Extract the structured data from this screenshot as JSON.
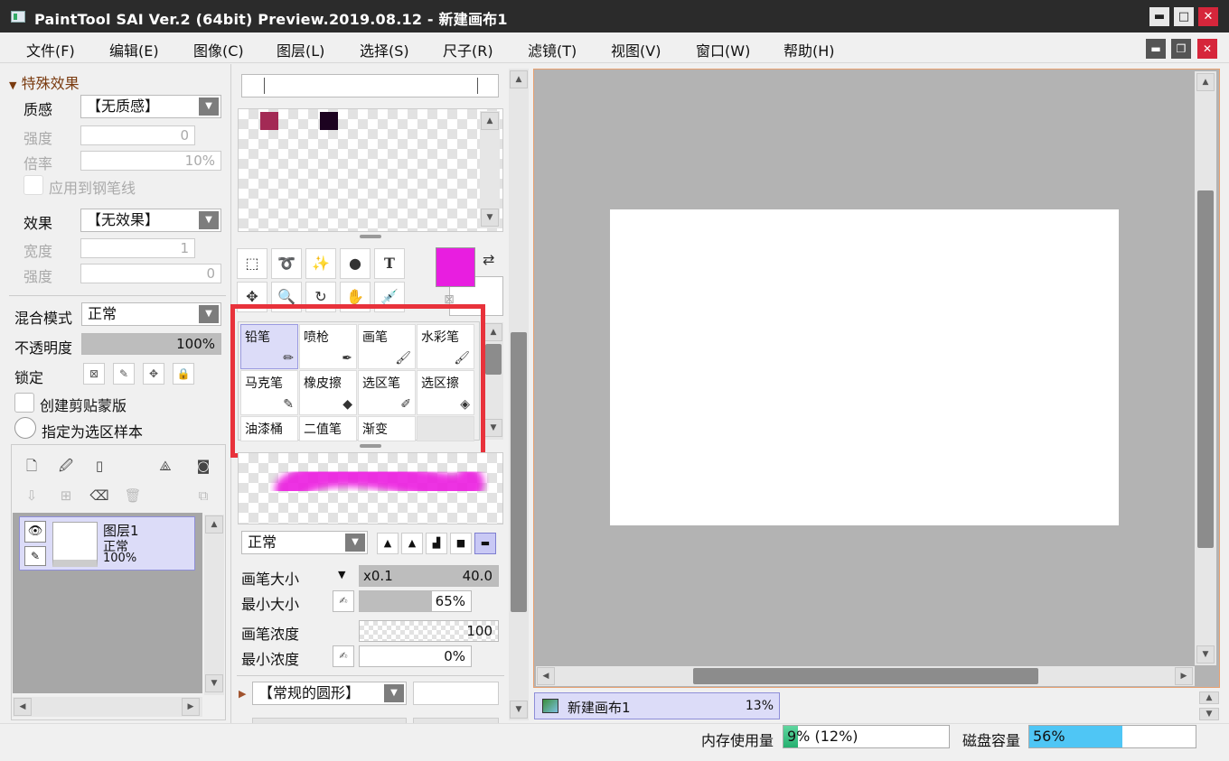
{
  "window": {
    "title": "PaintTool SAI Ver.2 (64bit) Preview.2019.08.12 - 新建画布1",
    "minimize": "▬",
    "maximize": "□",
    "close": "✕"
  },
  "menu": [
    "文件(F)",
    "编辑(E)",
    "图像(C)",
    "图层(L)",
    "选择(S)",
    "尺子(R)",
    "滤镜(T)",
    "视图(V)",
    "窗口(W)",
    "帮助(H)"
  ],
  "special_effects": {
    "header": "特殊效果",
    "texture_label": "质感",
    "texture_value": "【无质感】",
    "strength_label": "强度",
    "strength_value": "0",
    "scale_label": "倍率",
    "scale_value": "10%",
    "apply_pen_label": "应用到钢笔线",
    "effect_label": "效果",
    "effect_value": "【无效果】",
    "width_label": "宽度",
    "width_value": "1",
    "effect_strength_label": "强度",
    "effect_strength_value": "0"
  },
  "layer_props": {
    "blend_label": "混合模式",
    "blend_value": "正常",
    "opacity_label": "不透明度",
    "opacity_value": "100%",
    "opacity_fraction": 1.0,
    "lock_label": "锁定",
    "clip_label": "创建剪贴蒙版",
    "selection_source_label": "指定为选区样本"
  },
  "layers": [
    {
      "name": "图层1",
      "mode": "正常",
      "opacity": "100%"
    }
  ],
  "swatches": [
    "#a32a55",
    "#1c0320"
  ],
  "colors": {
    "primary": "#e81ee0",
    "secondary": "#ffffff",
    "highlight": "#e8323b"
  },
  "brushes": [
    {
      "name": "铅笔",
      "icon": "pencil-icon",
      "glyph": "✏"
    },
    {
      "name": "喷枪",
      "icon": "airbrush-icon",
      "glyph": "✒"
    },
    {
      "name": "画笔",
      "icon": "brush-icon",
      "glyph": "🖌"
    },
    {
      "name": "水彩笔",
      "icon": "watercolor-icon",
      "glyph": "🖌"
    },
    {
      "name": "马克笔",
      "icon": "marker-icon",
      "glyph": "✎"
    },
    {
      "name": "橡皮擦",
      "icon": "eraser-icon",
      "glyph": "◆"
    },
    {
      "name": "选区笔",
      "icon": "selection-pen-icon",
      "glyph": "✐"
    },
    {
      "name": "选区擦",
      "icon": "selection-eraser-icon",
      "glyph": "◈"
    },
    {
      "name": "油漆桶",
      "icon": "",
      "glyph": ""
    },
    {
      "name": "二值笔",
      "icon": "",
      "glyph": ""
    },
    {
      "name": "渐变",
      "icon": "",
      "glyph": ""
    }
  ],
  "brush_settings": {
    "mode_value": "正常",
    "size_label": "画笔大小",
    "size_multiplier": "x0.1",
    "size_value": "40.0",
    "min_size_label": "最小大小",
    "min_size_value": "65%",
    "min_size_fraction": 0.65,
    "density_label": "画笔浓度",
    "density_value": "100",
    "min_density_label": "最小浓度",
    "min_density_value": "0%",
    "shape_value": "【常规的圆形】"
  },
  "canvas_tab": {
    "name": "新建画布1",
    "zoom": "13%"
  },
  "status": {
    "memory_label": "内存使用量",
    "memory_value": "9% (12%)",
    "memory_fraction": 0.09,
    "disk_label": "磁盘容量",
    "disk_value": "56%",
    "disk_fraction": 0.56
  }
}
